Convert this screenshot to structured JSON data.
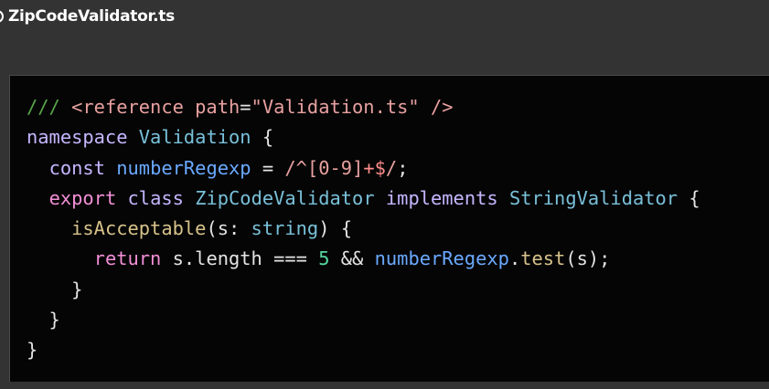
{
  "file": {
    "name": "ZipCodeValidator.ts",
    "icon": "file-icon"
  },
  "code_lines": [
    [
      {
        "t": "/// ",
        "c": "c-comment"
      },
      {
        "t": "<reference",
        "c": "c-tag"
      },
      {
        "t": " ",
        "c": "c-plain"
      },
      {
        "t": "path",
        "c": "c-attr"
      },
      {
        "t": "=",
        "c": "c-punc"
      },
      {
        "t": "\"Validation.ts\"",
        "c": "c-str"
      },
      {
        "t": " ",
        "c": "c-plain"
      },
      {
        "t": "/>",
        "c": "c-tag"
      }
    ],
    [
      {
        "t": "namespace",
        "c": "c-kw"
      },
      {
        "t": " ",
        "c": "c-plain"
      },
      {
        "t": "Validation",
        "c": "c-type"
      },
      {
        "t": " {",
        "c": "c-punc"
      }
    ],
    [
      {
        "t": "  ",
        "c": "c-plain"
      },
      {
        "t": "const",
        "c": "c-kw"
      },
      {
        "t": " ",
        "c": "c-plain"
      },
      {
        "t": "numberRegexp",
        "c": "c-var"
      },
      {
        "t": " = ",
        "c": "c-punc"
      },
      {
        "t": "/^[0-9]",
        "c": "c-regex"
      },
      {
        "t": "+$",
        "c": "c-regex-op"
      },
      {
        "t": "/",
        "c": "c-regex"
      },
      {
        "t": ";",
        "c": "c-punc"
      }
    ],
    [
      {
        "t": "  ",
        "c": "c-plain"
      },
      {
        "t": "export",
        "c": "c-kw2"
      },
      {
        "t": " ",
        "c": "c-plain"
      },
      {
        "t": "class",
        "c": "c-kw"
      },
      {
        "t": " ",
        "c": "c-plain"
      },
      {
        "t": "ZipCodeValidator",
        "c": "c-type"
      },
      {
        "t": " ",
        "c": "c-plain"
      },
      {
        "t": "implements",
        "c": "c-kw"
      },
      {
        "t": " ",
        "c": "c-plain"
      },
      {
        "t": "StringValidator",
        "c": "c-type"
      },
      {
        "t": " {",
        "c": "c-punc"
      }
    ],
    [
      {
        "t": "    ",
        "c": "c-plain"
      },
      {
        "t": "isAcceptable",
        "c": "c-fn"
      },
      {
        "t": "(s: ",
        "c": "c-punc"
      },
      {
        "t": "string",
        "c": "c-type"
      },
      {
        "t": ") {",
        "c": "c-punc"
      }
    ],
    [
      {
        "t": "      ",
        "c": "c-plain"
      },
      {
        "t": "return",
        "c": "c-kw2"
      },
      {
        "t": " s.length === ",
        "c": "c-plain"
      },
      {
        "t": "5",
        "c": "c-num"
      },
      {
        "t": " && ",
        "c": "c-plain"
      },
      {
        "t": "numberRegexp",
        "c": "c-var"
      },
      {
        "t": ".",
        "c": "c-punc"
      },
      {
        "t": "test",
        "c": "c-fn"
      },
      {
        "t": "(s);",
        "c": "c-punc"
      }
    ],
    [
      {
        "t": "    }",
        "c": "c-punc"
      }
    ],
    [
      {
        "t": "  }",
        "c": "c-punc"
      }
    ],
    [
      {
        "t": "}",
        "c": "c-punc"
      }
    ]
  ]
}
